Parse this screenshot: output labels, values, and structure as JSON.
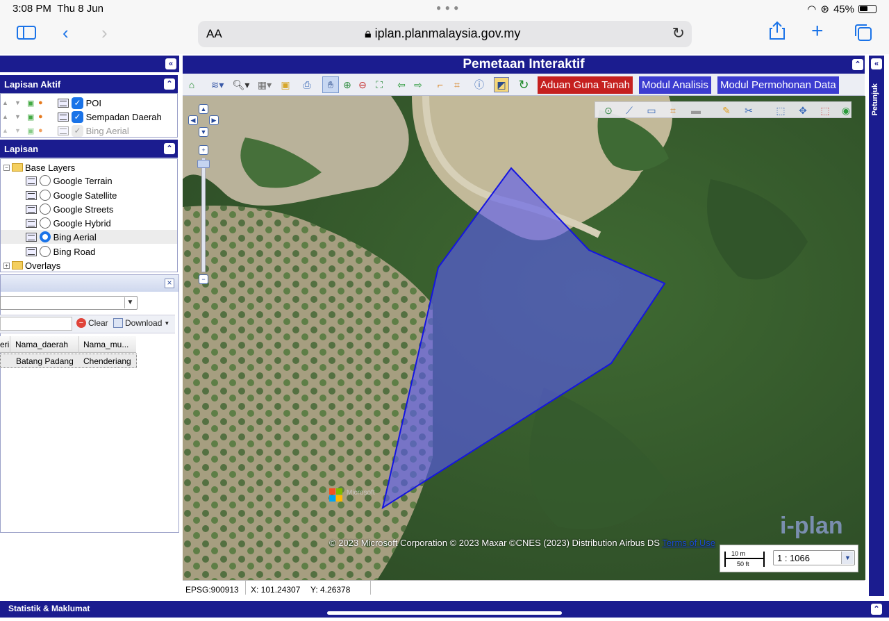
{
  "status": {
    "time": "3:08 PM",
    "date": "Thu 8 Jun",
    "battery": "45%"
  },
  "browser": {
    "aa": "AA",
    "url": "iplan.planmalaysia.gov.my"
  },
  "left": {
    "active_title": "Lapisan Aktif",
    "active_layers": [
      {
        "label": "POI",
        "checked": true
      },
      {
        "label": "Sempadan Daerah",
        "checked": true
      },
      {
        "label": "Bing Aerial",
        "checked": true,
        "dim": true
      }
    ],
    "layers_title": "Lapisan",
    "base_group": "Base Layers",
    "base_layers": [
      "Google Terrain",
      "Google Satellite",
      "Google Streets",
      "Google Hybrid",
      "Bing Aerial",
      "Bing Road"
    ],
    "selected_base": "Bing Aerial",
    "overlays_group": "Overlays"
  },
  "attr": {
    "clear_label": "Clear",
    "download_label": "Download",
    "columns": [
      "eri",
      "Nama_daerah",
      "Nama_mu..."
    ],
    "row": [
      "",
      "Batang Padang",
      "Chenderiang"
    ]
  },
  "map": {
    "title": "Pemetaan Interaktif",
    "buttons": {
      "aduan": "Aduan Guna Tanah",
      "analisis": "Modul Analisis",
      "permohonan": "Modul Permohonan Data"
    },
    "attribution": "© 2023 Microsoft Corporation © 2023 Maxar ©CNES (2023) Distribution Airbus DS",
    "terms": "Terms of Use",
    "scale_m": "10 m",
    "scale_ft": "50 ft",
    "scale_ratio": "1 : 1066",
    "logo_text": "i-plan",
    "ms_text": "Microsoft",
    "accent": "#1b1c8f",
    "polygon_fill": "#5a5af0"
  },
  "statusline": {
    "epsg": "EPSG:900913",
    "x": "X: 101.24307",
    "y": "Y: 4.26378"
  },
  "side_label": "Petunjuk",
  "bottom_label": "Statistik & Maklumat"
}
